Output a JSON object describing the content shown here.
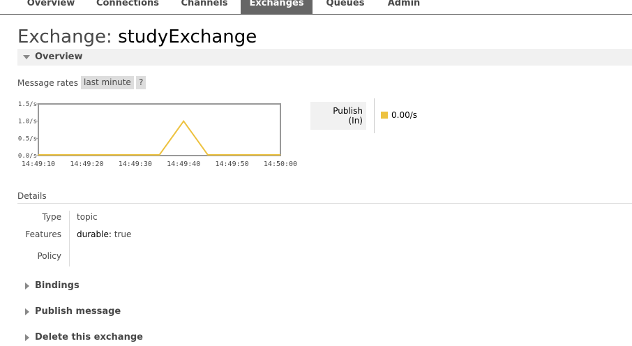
{
  "nav": {
    "tabs": [
      {
        "label": "Overview",
        "active": false
      },
      {
        "label": "Connections",
        "active": false
      },
      {
        "label": "Channels",
        "active": false
      },
      {
        "label": "Exchanges",
        "active": true
      },
      {
        "label": "Queues",
        "active": false
      },
      {
        "label": "Admin",
        "active": false
      }
    ]
  },
  "page": {
    "title_prefix": "Exchange:",
    "exchange_name": "studyExchange"
  },
  "overview": {
    "heading": "Overview",
    "message_rates_label": "Message rates",
    "range_button": "last minute",
    "help_button": "?",
    "legend": {
      "label_line1": "Publish",
      "label_line2": "(In)",
      "value": "0.00/s",
      "color": "#edc240"
    }
  },
  "chart_data": {
    "type": "line",
    "x": [
      "14:49:10",
      "14:49:20",
      "14:49:30",
      "14:49:35",
      "14:49:40",
      "14:49:45",
      "14:49:50",
      "14:50:00"
    ],
    "series": [
      {
        "name": "Publish (In)",
        "values": [
          0.0,
          0.0,
          0.0,
          0.0,
          1.0,
          0.0,
          0.0,
          0.0
        ],
        "color": "#edc240"
      }
    ],
    "x_ticks": [
      "14:49:10",
      "14:49:20",
      "14:49:30",
      "14:49:40",
      "14:49:50",
      "14:50:00"
    ],
    "y_ticks": [
      "0.0/s",
      "0.5/s",
      "1.0/s",
      "1.5/s"
    ],
    "ylim": [
      0,
      1.5
    ],
    "grid": false
  },
  "details": {
    "title": "Details",
    "rows": [
      {
        "key": "Type",
        "value": "topic"
      },
      {
        "key": "Features",
        "value_key": "durable:",
        "value": "true"
      },
      {
        "key": "Policy",
        "value": ""
      }
    ]
  },
  "sections": {
    "bindings": "Bindings",
    "publish_message": "Publish message",
    "delete_exchange": "Delete this exchange"
  }
}
